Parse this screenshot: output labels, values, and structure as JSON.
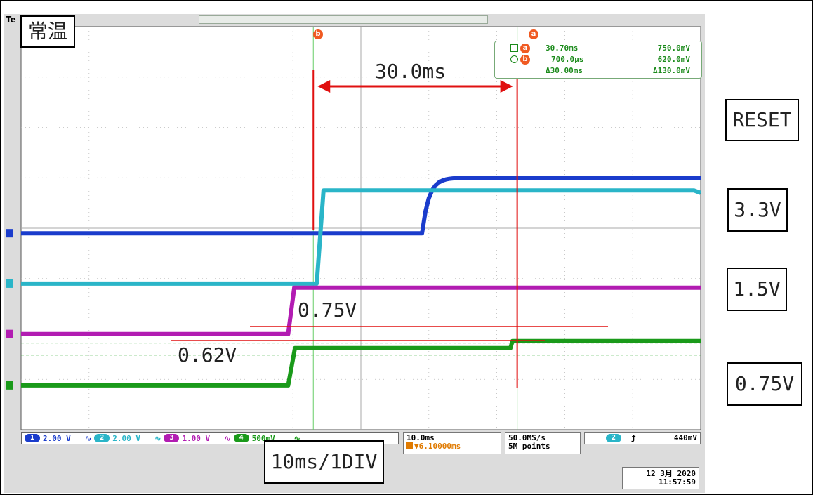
{
  "scope": {
    "logo": "Te",
    "condition_label": "常温",
    "cursor_markers": {
      "a": "a",
      "b": "b"
    },
    "cursor_readout": {
      "a_time": "30.70ms",
      "a_value": "750.0mV",
      "b_time": "700.0µs",
      "b_value": "620.0mV",
      "delta_time": "Δ30.00ms",
      "delta_value": "Δ130.0mV"
    },
    "annotations": {
      "interval": "30.0ms",
      "level_high": "0.75V",
      "level_low": "0.62V",
      "timebase_label": "10ms/1DIV"
    },
    "channel_scales": [
      {
        "num": "1",
        "scale": "2.00 V",
        "color": "#1a3ccc"
      },
      {
        "num": "2",
        "scale": "2.00 V",
        "color": "#2ab5c8"
      },
      {
        "num": "3",
        "scale": "1.00 V",
        "color": "#b21cb2"
      },
      {
        "num": "4",
        "scale": "500mV",
        "color": "#1a9a1a"
      }
    ],
    "timebase": {
      "per_div": "10.0ms",
      "position": "▼6.10000ms"
    },
    "acquisition": {
      "rate": "50.0MS/s",
      "points": "5M points"
    },
    "trigger": {
      "channel": "2",
      "slope": "ƒ",
      "level": "440mV"
    },
    "datetime": {
      "date": "12 3月 2020",
      "time": "11:57:59"
    }
  },
  "side_labels": [
    "RESET",
    "3.3V",
    "1.5V",
    "0.75V"
  ],
  "chart_data": {
    "type": "line",
    "title": "",
    "xlabel": "",
    "ylabel": "",
    "x_divisions": 10,
    "y_divisions": 8,
    "time_per_div_ms": 10,
    "grid": true,
    "series": [
      {
        "name": "RESET",
        "channel": 1,
        "color": "#1a3ccc",
        "kind": "rise_curve",
        "t_start_ms": 59.0,
        "tau_ms": 1.0,
        "low_div": 3.9,
        "high_div": 5.0
      },
      {
        "name": "3.3V",
        "channel": 2,
        "color": "#2ab5c8",
        "kind": "ramp",
        "t_start_ms": 43.5,
        "t_end_ms": 44.5,
        "low_div": 2.9,
        "high_div": 4.75,
        "tail_dip": true
      },
      {
        "name": "1.5V",
        "channel": 3,
        "color": "#b21cb2",
        "kind": "ramp",
        "t_start_ms": 39.3,
        "t_end_ms": 40.2,
        "low_div": 1.9,
        "high_div": 2.82
      },
      {
        "name": "0.75V",
        "channel": 4,
        "color": "#1a9a1a",
        "kind": "two_step",
        "t_start_ms": 39.3,
        "t_end_ms": 40.3,
        "low_div": 0.88,
        "mid_div": 1.62,
        "t_step2_ms": 72.0,
        "high_div": 1.76
      }
    ],
    "cursors": [
      {
        "id": "a",
        "t_ms": 73.0,
        "value": "750.0mV"
      },
      {
        "id": "b",
        "t_ms": 43.0,
        "value": "620.0mV"
      }
    ],
    "reference_levels_div": [
      1.72,
      1.48
    ]
  }
}
